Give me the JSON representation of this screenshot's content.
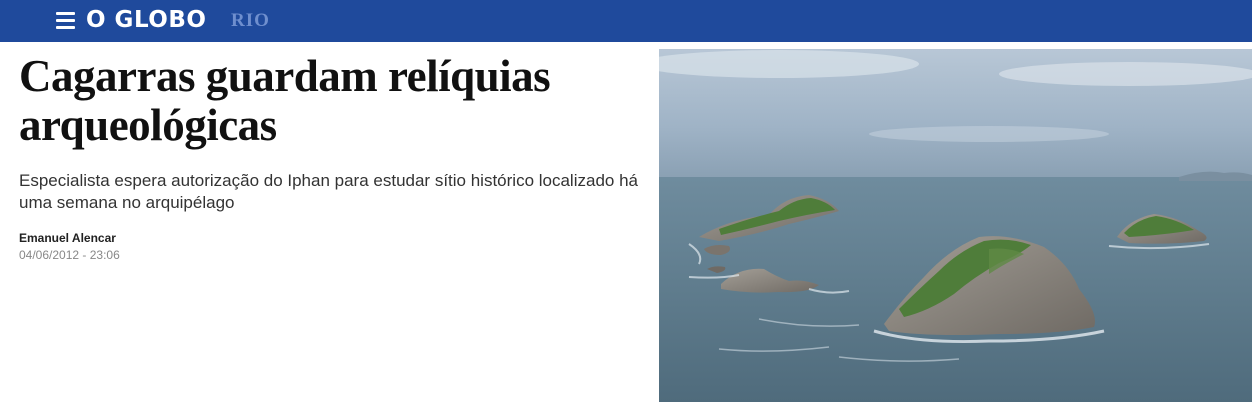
{
  "header": {
    "menu_icon": "hamburger-menu-icon",
    "logo_text": "O GLOBO",
    "section": "RIO",
    "colors": {
      "bar": "#1f4a9c",
      "section_text": "#6f8fce"
    }
  },
  "article": {
    "headline": "Cagarras guardam relíquias arqueológicas",
    "subtitle": "Especialista espera autorização do Iphan para estudar sítio histórico localizado há uma semana no arquipélago",
    "author": "Emanuel Alencar",
    "datetime": "04/06/2012 - 23:06"
  },
  "photo": {
    "subject": "aerial-islands-photo",
    "colors": {
      "sky": "#9db2c7",
      "sea": "#5d7a8a",
      "rock": "#8a8580",
      "vegetation": "#4f7d3a"
    }
  }
}
